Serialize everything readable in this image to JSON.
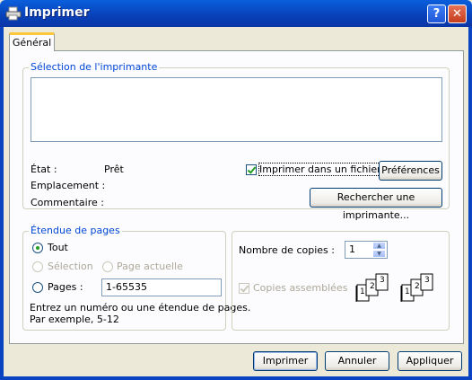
{
  "window": {
    "title": "Imprimer",
    "help": "?",
    "close": "✕"
  },
  "tabs": [
    {
      "label": "Général"
    }
  ],
  "printer_select": {
    "group_title": "Sélection de l'imprimante",
    "status_label": "État :",
    "status_value": "Prêt",
    "location_label": "Emplacement :",
    "comment_label": "Commentaire :",
    "print_to_file": {
      "label": "Imprimer dans un fichier",
      "checked": true
    },
    "preferences_button": "Préférences",
    "find_printer_button": "Rechercher une imprimante..."
  },
  "page_range": {
    "group_title": "Étendue de pages",
    "all": {
      "label": "Tout",
      "selected": true
    },
    "selection": {
      "label": "Sélection",
      "enabled": false
    },
    "current_page": {
      "label": "Page actuelle",
      "enabled": false
    },
    "pages": {
      "label": "Pages :",
      "value": "1-65535"
    },
    "help_line1": "Entrez un numéro ou une étendue de pages.",
    "help_line2": "Par exemple, 5-12"
  },
  "copies": {
    "count_label": "Nombre de copies :",
    "count_value": "1",
    "collate": {
      "label": "Copies assemblées",
      "checked": true,
      "enabled": false
    },
    "collate_icon_pages": [
      "1",
      "2",
      "3"
    ]
  },
  "footer": {
    "print_button": "Imprimer",
    "cancel_button": "Annuler",
    "apply_button": "Appliquer"
  },
  "colors": {
    "titlebar": "#0a5fdc",
    "group_title": "#0046d5",
    "background": "#ece9d8"
  }
}
